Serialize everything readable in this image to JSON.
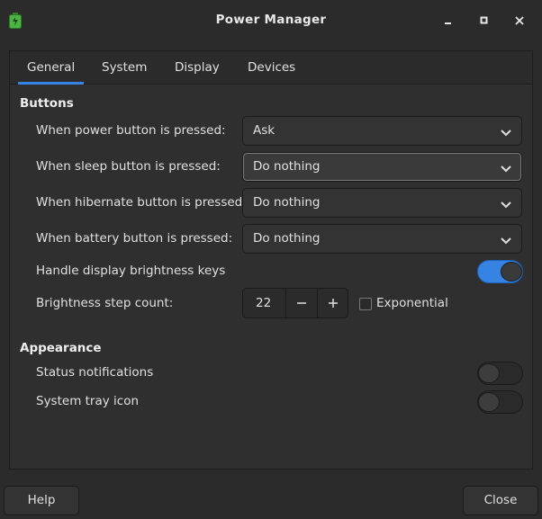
{
  "window": {
    "title": "Power Manager",
    "icon": "battery-icon"
  },
  "tabs": [
    {
      "label": "General",
      "active": true
    },
    {
      "label": "System",
      "active": false
    },
    {
      "label": "Display",
      "active": false
    },
    {
      "label": "Devices",
      "active": false
    }
  ],
  "buttons_section": {
    "title": "Buttons",
    "power": {
      "label": "When power button is pressed:",
      "value": "Ask"
    },
    "sleep": {
      "label": "When sleep button is pressed:",
      "value": "Do nothing"
    },
    "hibernate": {
      "label": "When hibernate button is pressed:",
      "value": "Do nothing"
    },
    "battery": {
      "label": "When battery button is pressed:",
      "value": "Do nothing"
    },
    "brightness_keys": {
      "label": "Handle display brightness keys",
      "on": true
    },
    "brightness_step": {
      "label": "Brightness step count:",
      "value": "22",
      "exponential_label": "Exponential",
      "exponential_checked": false
    }
  },
  "appearance_section": {
    "title": "Appearance",
    "status_notifications": {
      "label": "Status notifications",
      "on": false
    },
    "tray_icon": {
      "label": "System tray icon",
      "on": false
    }
  },
  "footer": {
    "help_label": "Help",
    "close_label": "Close"
  },
  "colors": {
    "accent": "#3584e4",
    "battery_icon": "#4bb543"
  }
}
